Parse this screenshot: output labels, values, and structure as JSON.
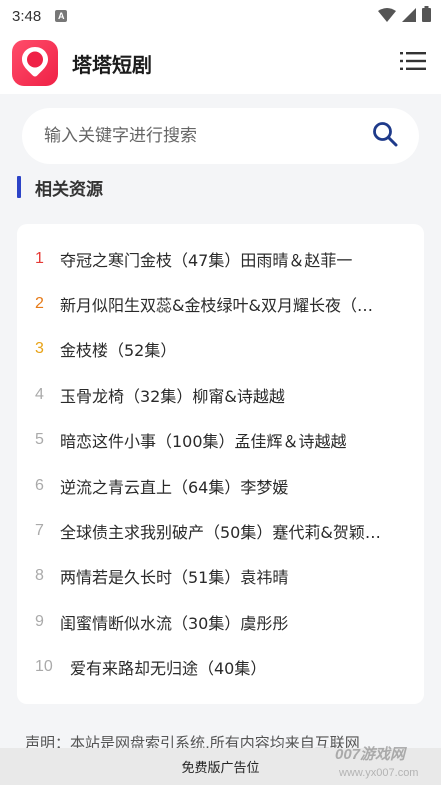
{
  "status_bar": {
    "time": "3:48",
    "notification_badge": "A",
    "icons": [
      "wifi-icon",
      "signal-icon",
      "battery-icon"
    ]
  },
  "header": {
    "app_title": "塔塔短剧",
    "logo_icon": "location-pin-icon",
    "menu_icon": "hamburger-menu-icon",
    "brand_color": "#ef2146"
  },
  "search": {
    "placeholder": "输入关键字进行搜索",
    "value": "",
    "icon": "search-icon",
    "icon_color": "#1e3a8a"
  },
  "section": {
    "title": "相关资源",
    "accent_color": "#2c43c7"
  },
  "results": [
    {
      "rank": "1",
      "title": "夺冠之寒门金枝（47集）田雨晴＆赵菲一"
    },
    {
      "rank": "2",
      "title": "新月似阳生双蕊&金枝绿叶&双月耀长夜（…"
    },
    {
      "rank": "3",
      "title": "金枝楼（52集）"
    },
    {
      "rank": "4",
      "title": "玉骨龙椅（32集）柳甯&诗越越"
    },
    {
      "rank": "5",
      "title": "暗恋这件小事（100集）孟佳辉＆诗越越"
    },
    {
      "rank": "6",
      "title": "逆流之青云直上（64集）李梦媛"
    },
    {
      "rank": "7",
      "title": "全球债主求我别破产（50集）蹇代莉&贺颖…"
    },
    {
      "rank": "8",
      "title": "两情若是久长时（51集）袁祎晴"
    },
    {
      "rank": "9",
      "title": "闺蜜情断似水流（30集）虞彤彤"
    },
    {
      "rank": "10",
      "title": "爱有来路却无归途（40集）"
    }
  ],
  "footer": {
    "disclaimer": "声明：本站是网盘索引系统,所有内容均来自互联网",
    "ad_text": "免费版广告位",
    "watermark": "007游戏网 www.yx007.com"
  }
}
